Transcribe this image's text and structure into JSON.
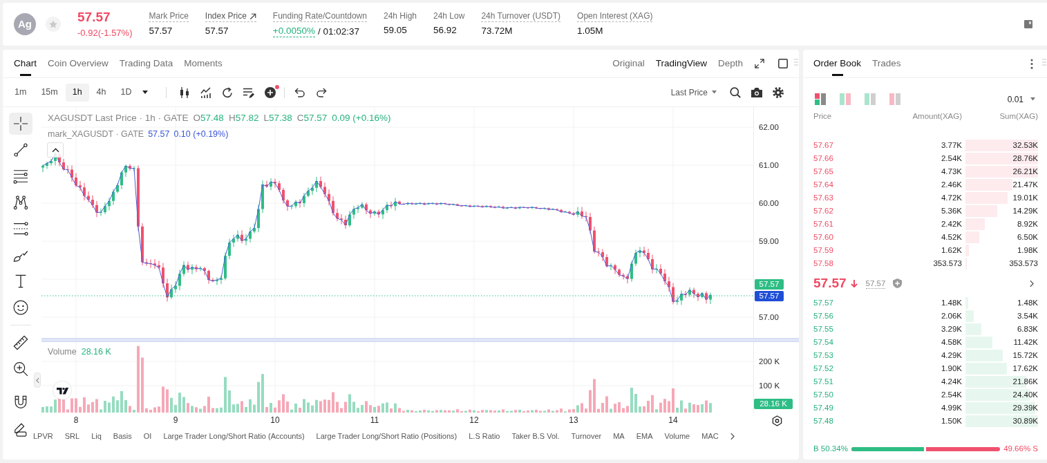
{
  "header": {
    "avatar": "Ag",
    "favorite": false,
    "price": "57.57",
    "change": "-0.92(-1.57%)",
    "falling": true,
    "stats": [
      {
        "label": "Mark Price",
        "underlined": true,
        "link": false,
        "value": "57.57",
        "positive": false
      },
      {
        "label": "Index Price",
        "underlined": true,
        "link": true,
        "value": "57.57",
        "positive": false
      },
      {
        "label": "Funding Rate/Countdown",
        "underlined": true,
        "link": false,
        "value": "+0.0050%",
        "positive": true,
        "suffix": "/ 01:02:37"
      },
      {
        "label": "24h High",
        "underlined": false,
        "link": false,
        "value": "59.05",
        "positive": false
      },
      {
        "label": "24h Low",
        "underlined": false,
        "link": false,
        "value": "56.92",
        "positive": false
      },
      {
        "label": "24h Turnover (USDT)",
        "underlined": true,
        "link": false,
        "value": "73.72M",
        "positive": false
      },
      {
        "label": "Open Interest (XAG)",
        "underlined": true,
        "link": false,
        "value": "1.05M",
        "positive": false
      }
    ]
  },
  "chart_panel": {
    "tabs": [
      {
        "label": "Chart",
        "selected": true
      },
      {
        "label": "Coin Overview",
        "selected": false
      },
      {
        "label": "Trading Data",
        "selected": false
      },
      {
        "label": "Moments",
        "selected": false
      }
    ],
    "views": [
      {
        "label": "Original",
        "selected": false
      },
      {
        "label": "TradingView",
        "selected": true
      },
      {
        "label": "Depth",
        "selected": false
      }
    ],
    "intervals": [
      {
        "label": "1m",
        "selected": false
      },
      {
        "label": "15m",
        "selected": false
      },
      {
        "label": "1h",
        "selected": true
      },
      {
        "label": "4h",
        "selected": false
      },
      {
        "label": "1D",
        "selected": false
      }
    ],
    "indicator_alert": true,
    "price_source": "Last Price",
    "drawing_tools": [
      {
        "kind": "crosshair",
        "selected": true
      },
      {
        "kind": "trend_line",
        "selected": false
      },
      {
        "kind": "parallel_lines",
        "selected": false
      },
      {
        "kind": "pattern",
        "selected": false
      },
      {
        "kind": "fib_levels",
        "selected": false
      },
      {
        "kind": "brush",
        "selected": false
      },
      {
        "kind": "text",
        "selected": false
      },
      {
        "kind": "emoji",
        "selected": false
      },
      {
        "kind": "ruler",
        "selected": false
      },
      {
        "kind": "zoom_in",
        "selected": false
      },
      {
        "kind": "magnet",
        "selected": false
      },
      {
        "kind": "draw_lock",
        "selected": false
      }
    ],
    "legend": {
      "title": "XAGUSDT Last Price · 1h · GATE",
      "ohlc": [
        {
          "label": "O",
          "value": "57.48"
        },
        {
          "label": "H",
          "value": "57.82"
        },
        {
          "label": "L",
          "value": "57.38"
        },
        {
          "label": "C",
          "value": "57.57"
        }
      ],
      "change": "0.09 (+0.16%)"
    },
    "mark_legend": {
      "title": "mark_XAGUSDT · GATE",
      "price": "57.57",
      "change": "0.10 (+0.19%)"
    },
    "price_axis": [
      "62.00",
      "61.00",
      "60.00",
      "59.00",
      "57.00"
    ],
    "price_tags": [
      {
        "kind": "last",
        "text": "57.57"
      },
      {
        "kind": "mark",
        "text": "57.57"
      }
    ],
    "volume": {
      "label": "Volume",
      "value": "28.16 K",
      "axis": [
        "200 K",
        "100 K"
      ],
      "tag": "28.16 K"
    },
    "time_axis": [
      "8",
      "9",
      "10",
      "11",
      "12",
      "13",
      "14"
    ],
    "indicators": [
      "LPVR",
      "SRL",
      "Liq",
      "Basis",
      "OI",
      "Large Trader Long/Short Ratio (Accounts)",
      "Large Trader Long/Short Ratio (Positions)",
      "L.S Ratio",
      "Taker B.S Vol.",
      "Turnover",
      "MA",
      "EMA",
      "Volume",
      "MAC"
    ]
  },
  "order_book": {
    "tabs": [
      {
        "label": "Order Book",
        "selected": true
      },
      {
        "label": "Trades",
        "selected": false
      }
    ],
    "view_modes": [
      {
        "kind": "combined",
        "selected": true
      },
      {
        "kind": "side_by_side",
        "selected": false
      },
      {
        "kind": "bids_only",
        "selected": false
      },
      {
        "kind": "asks_only",
        "selected": false
      }
    ],
    "precision": "0.01",
    "columns": [
      "Price",
      "Amount(XAG)",
      "Sum(XAG)"
    ],
    "asks": [
      {
        "price": "57.67",
        "amount": "3.77K",
        "sum": "32.53K",
        "level": 1
      },
      {
        "price": "57.66",
        "amount": "2.54K",
        "sum": "28.76K",
        "level": 1
      },
      {
        "price": "57.65",
        "amount": "4.73K",
        "sum": "26.21K",
        "level": 1
      },
      {
        "price": "57.64",
        "amount": "2.46K",
        "sum": "21.47K",
        "level": 0.65
      },
      {
        "price": "57.63",
        "amount": "4.72K",
        "sum": "19.01K",
        "level": 0.58
      },
      {
        "price": "57.62",
        "amount": "5.36K",
        "sum": "14.29K",
        "level": 0.44
      },
      {
        "price": "57.61",
        "amount": "2.42K",
        "sum": "8.92K",
        "level": 0.27
      },
      {
        "price": "57.60",
        "amount": "4.52K",
        "sum": "6.50K",
        "level": 0.19
      },
      {
        "price": "57.59",
        "amount": "1.62K",
        "sum": "1.98K",
        "level": 0.05
      },
      {
        "price": "57.58",
        "amount": "353.573",
        "sum": "353.573",
        "level": 0.02
      }
    ],
    "last_price": "57.57",
    "falling": true,
    "mark_price": "57.57",
    "bids": [
      {
        "price": "57.57",
        "amount": "1.48K",
        "sum": "1.48K",
        "level": 0.04
      },
      {
        "price": "57.56",
        "amount": "2.06K",
        "sum": "3.54K",
        "level": 0.11
      },
      {
        "price": "57.55",
        "amount": "3.29K",
        "sum": "6.83K",
        "level": 0.22
      },
      {
        "price": "57.54",
        "amount": "4.58K",
        "sum": "11.42K",
        "level": 0.37
      },
      {
        "price": "57.53",
        "amount": "4.29K",
        "sum": "15.72K",
        "level": 0.51
      },
      {
        "price": "57.52",
        "amount": "1.90K",
        "sum": "17.62K",
        "level": 0.57
      },
      {
        "price": "57.51",
        "amount": "4.24K",
        "sum": "21.86K",
        "level": 0.84
      },
      {
        "price": "57.50",
        "amount": "2.54K",
        "sum": "24.40K",
        "level": 0.89
      },
      {
        "price": "57.49",
        "amount": "4.99K",
        "sum": "29.39K",
        "level": 0.96
      },
      {
        "price": "57.48",
        "amount": "1.50K",
        "sum": "30.89K",
        "level": 1
      }
    ],
    "ratio": {
      "buy": "B 50.34%",
      "sell": "49.66% S",
      "level": 0.5034
    }
  }
}
